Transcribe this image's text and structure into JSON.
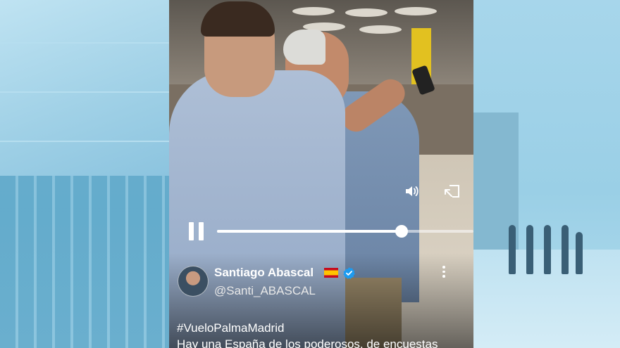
{
  "tweet": {
    "author_name": "Santiago Abascal",
    "flag": "🇪🇸",
    "handle": "@Santi_ABASCAL",
    "hashtag": "#VueloPalmaMadrid",
    "text": "Hay una España de los poderosos, de encuestas"
  },
  "player": {
    "progress_fraction": 0.72,
    "icons": [
      "pause-icon",
      "volume-icon",
      "cast-icon",
      "more-icon",
      "verified-icon"
    ]
  },
  "colors": {
    "background_tint": "#8ec9e3",
    "verified": "#1d9bf0",
    "overlay_text": "#ffffff"
  }
}
